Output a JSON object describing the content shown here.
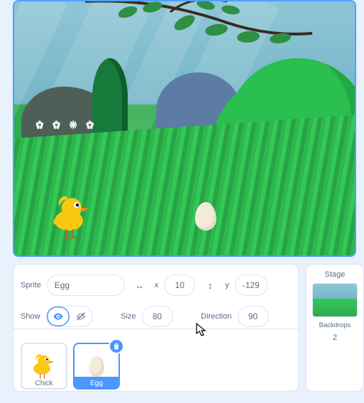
{
  "sprite_info": {
    "label_sprite": "Sprite",
    "name_value": "Egg",
    "label_x": "x",
    "x_value": "10",
    "label_y": "y",
    "y_value": "-129",
    "label_show": "Show",
    "label_size": "Size",
    "size_value": "80",
    "label_direction": "Direction",
    "direction_value": "90",
    "icon_xy": "↔",
    "icon_ydir": "↕"
  },
  "sprites": {
    "chick": {
      "label": "Chick",
      "selected": false
    },
    "egg": {
      "label": "Egg",
      "selected": true
    }
  },
  "stage_panel": {
    "title": "Stage",
    "backdrops_label": "Backdrops",
    "backdrops_count": "2"
  }
}
